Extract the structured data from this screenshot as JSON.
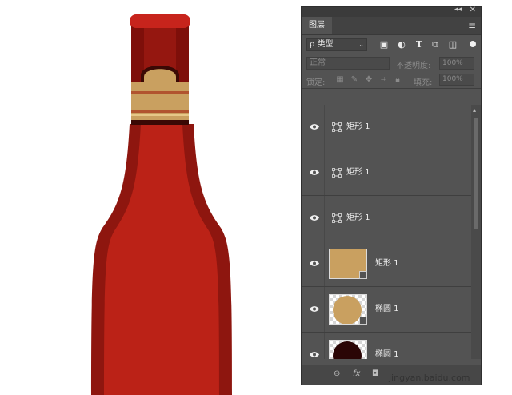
{
  "panel": {
    "tab_label": "图层",
    "collapse_arrows": "◂◂",
    "close": "✕",
    "menu": "≡",
    "filter_kind": "ρ 类型",
    "blend_mode": "正常",
    "opacity_label": "不透明度:",
    "opacity_value": "100%",
    "lock_label": "锁定:",
    "fill_label": "填充:",
    "fill_value": "100%"
  },
  "layers": [
    {
      "name": "矩形 1",
      "type": "shape"
    },
    {
      "name": "矩形 1",
      "type": "shape"
    },
    {
      "name": "矩形 1",
      "type": "shape"
    },
    {
      "name": "矩形 1",
      "type": "thumb-rect",
      "color": "#c9a060"
    },
    {
      "name": "椭圆 1",
      "type": "thumb-ellipse",
      "color": "#c9a060"
    },
    {
      "name": "椭圆 1",
      "type": "thumb-ellipse",
      "color": "#2a0505"
    }
  ],
  "bottom_icons": {
    "link": "⊖",
    "fx": "fx",
    "mask": "◘"
  },
  "watermark": "jingyan.baidu.com",
  "colors": {
    "bottle_red": "#b8201a",
    "bottle_dark": "#8e160f",
    "neck_dark": "#7a1009",
    "label_tan": "#c9a060"
  }
}
